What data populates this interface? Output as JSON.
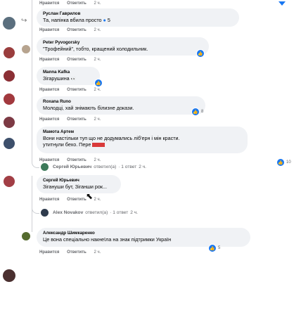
{
  "top_actions": {
    "like": "Нравится",
    "reply": "Ответить",
    "time": "2 ч."
  },
  "comments": [
    {
      "author": "Руслан Гаврилов",
      "text": "Та, напінка вбила пpocто",
      "reactions": "5",
      "like": "Нравится",
      "reply": "Ответить",
      "time": "2 ч."
    },
    {
      "author": "Peter Pyvogorsky",
      "text": "\"Трофейний\", тобто, кращений холодильник.",
      "like": "Нравится",
      "reply": "Ответить",
      "time": "2 ч."
    },
    {
      "author": "Manna Kafka",
      "text": "Зігарушина",
      "like": "Нравится",
      "reply": "Ответить",
      "time": "2 ч."
    },
    {
      "author": "Roxana Runo",
      "text": "Молодці, хай знімають білизне докази.",
      "reactions": "8",
      "like": "Нравится",
      "reply": "Ответить",
      "time": "2 ч."
    },
    {
      "author": "Мамота Артем",
      "text": "Вони нaстільки туп що не додумались ліб'ерн і мін красти.",
      "text2": "утитнули бехо. Пере",
      "reactions": "10",
      "like": "Нравится",
      "reply": "Ответить",
      "time": "2 ч."
    }
  ],
  "reply_thread_1": {
    "name": "Сергей Юрьевич",
    "action": "ответил(а)",
    "count": "· 1 ответ",
    "time": "2 ч."
  },
  "nested_reply": {
    "author": "Сергей Юрьевич",
    "text": "Зігануши бут, Зіганши рок...",
    "like": "Нравится",
    "reply": "Ответить",
    "time": "2 ч."
  },
  "reply_thread_2": {
    "name": "Alex Novakov",
    "action": "ответил(а)",
    "count": "· 1 ответ",
    "time": "2 ч."
  },
  "last_comment": {
    "author": "Александр Шимкаренко",
    "text": "Це вона спеціально накнеїла на знак підтримки Україн",
    "reactions": "5",
    "like": "Нравится",
    "reply": "Ответить",
    "time": "2 ч."
  }
}
